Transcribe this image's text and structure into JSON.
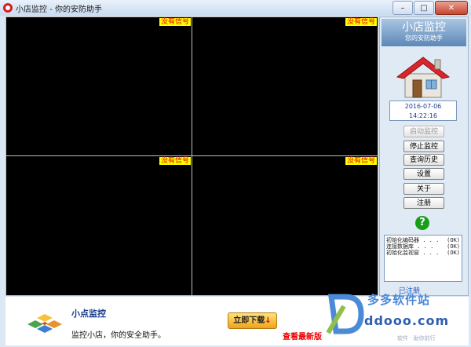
{
  "window": {
    "title": "小店监控 - 你的安防助手",
    "minimize_glyph": "–",
    "maximize_glyph": "□",
    "close_glyph": "✕"
  },
  "video": {
    "panes": [
      {
        "status": "没有信号"
      },
      {
        "status": "没有信号"
      },
      {
        "status": "没有信号"
      },
      {
        "status": "没有信号"
      }
    ]
  },
  "sidebar": {
    "brand_title": "小店监控",
    "brand_subtitle": "您的安防助手",
    "date": "2016-07-06",
    "time": "14:22:16",
    "buttons": {
      "start": "启动监控",
      "stop": "停止监控",
      "history": "查询历史",
      "settings": "设置",
      "about": "关于",
      "register": "注册"
    },
    "help_glyph": "?",
    "log": [
      {
        "text": "初始化编码器 . . .",
        "status": "(OK)"
      },
      {
        "text": "连接数据库 . . .",
        "status": "(OK)"
      },
      {
        "text": "初始化监视窗 . . .",
        "status": "(OK)"
      }
    ],
    "reg_status": "已注册"
  },
  "ad": {
    "title": "小点监控",
    "text": "监控小店，你的安全助手。",
    "download": "立即下载",
    "download_arrow": "↓",
    "new_version": "查看最新版"
  },
  "watermark": {
    "name": "多多软件站",
    "url": "ddooo.com",
    "sub": "软件 · 助你前行"
  },
  "colors": {
    "no_signal_bg": "#ffff00",
    "no_signal_fg": "#e00000",
    "accent": "#1a3d8f",
    "help_green": "#1a9e1a"
  },
  "icons": [
    "app-icon",
    "house-icon",
    "help-icon",
    "ad-logo-icon",
    "watermark-logo-icon"
  ]
}
